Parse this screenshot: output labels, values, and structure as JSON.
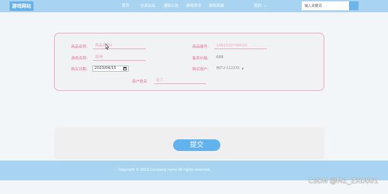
{
  "header": {
    "logo": "游戏网站",
    "nav": [
      "首页",
      "交流论坛",
      "通知公告",
      "游戏资讯",
      "游戏商城"
    ],
    "my_menu": "我的",
    "search_placeholder": "输入关键词"
  },
  "form": {
    "product_name_label": "商品名称:",
    "product_name_value": "商品名称1",
    "product_no_label": "商品编号:",
    "product_no_value": "1681525749021",
    "game_name_label": "游戏名称:",
    "game_name_value": "原神",
    "price_label": "售卖价格:",
    "price_value": "688",
    "purchase_date_label": "购买日期:",
    "purchase_date_value": "2023/04/15",
    "buyer_label": "购买用户:",
    "buyer_value": "用户2-112233",
    "user_name_label": "用户姓名:",
    "user_name_value": "张三"
  },
  "actions": {
    "submit_label": "提交"
  },
  "footer": {
    "copyright": "Copyright © 2023 Company name All rights reserved."
  },
  "watermark": "CSDN @MZ_ZXD001",
  "colors": {
    "header_bg": "#a8d4f2",
    "accent": "#62b2ee",
    "label_pink": "#e0709a"
  }
}
